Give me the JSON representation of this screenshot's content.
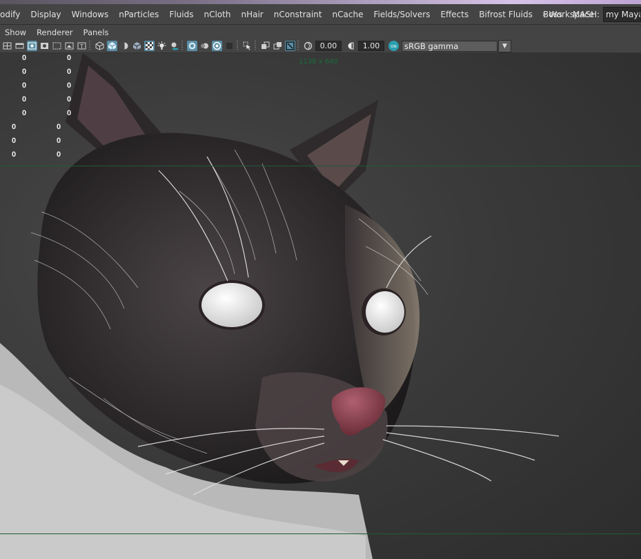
{
  "menubar": {
    "items": [
      "odify",
      "Display",
      "Windows",
      "nParticles",
      "Fluids",
      "nCloth",
      "nHair",
      "nConstraint",
      "nCache",
      "Fields/Solvers",
      "Effects",
      "Bifrost Fluids",
      "Boss",
      "MASH"
    ],
    "overflow_icon": "double-chevron-right-icon",
    "workspace_label": "Workspace :",
    "workspace_value": "my Maya"
  },
  "panel_menu": {
    "items": [
      "Show",
      "Renderer",
      "Panels"
    ]
  },
  "toolbar": {
    "exposure_value": "0.00",
    "gamma_value": "1.00",
    "color_space": "sRGB gamma",
    "icons": [
      "camera-attributes-icon",
      "film-gate-icon",
      "resolution-gate-icon",
      "gate-mask-icon",
      "field-chart-icon",
      "safe-action-icon",
      "safe-title-icon",
      "wireframe-icon",
      "smooth-shade-icon",
      "wireframe-on-shaded-icon",
      "default-material-icon",
      "textured-icon",
      "use-all-lights-icon",
      "shadows-icon",
      "screen-space-ao-icon",
      "motion-blur-icon",
      "anti-aliasing-icon",
      "depth-of-field-icon",
      "isolate-select-icon",
      "xray-icon",
      "xray-joints-icon",
      "xray-components-icon",
      "exposure-icon",
      "gamma-icon",
      "color-management-icon",
      "dropdown-arrow-icon"
    ]
  },
  "viewport": {
    "resolution_gate": "1138 x 640",
    "hud_rows": [
      {
        "left": "0",
        "right": "0"
      },
      {
        "left": "0",
        "right": "0"
      },
      {
        "left": "0",
        "right": "0"
      },
      {
        "left": "0",
        "right": "0"
      },
      {
        "left": "0",
        "right": "0"
      },
      {
        "left": "0",
        "right": "0"
      },
      {
        "left": "0",
        "right": "0"
      },
      {
        "left": "0",
        "right": "0"
      }
    ]
  },
  "colors": {
    "menubar_bg": "#444444",
    "active_icon": "#5b8ea6",
    "gate_line": "#1f5a36"
  }
}
